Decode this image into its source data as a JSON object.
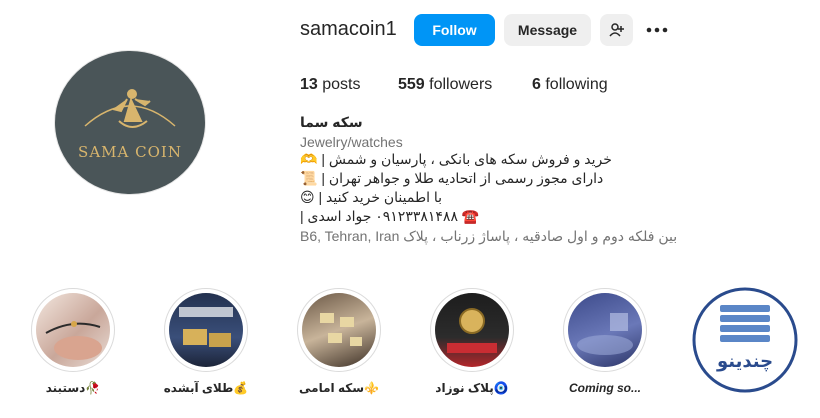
{
  "profile": {
    "username": "samacoin1",
    "avatar_brand": "SAMA COIN",
    "buttons": {
      "follow": "Follow",
      "message": "Message"
    },
    "icons": {
      "add_user": "add-user-icon",
      "more": "more-horizontal-icon"
    }
  },
  "stats": {
    "posts_count": "13",
    "posts_label": " posts",
    "followers_count": "559",
    "followers_label": " followers",
    "following_count": "6",
    "following_label": " following"
  },
  "bio": {
    "name": "سکه سما",
    "category": "Jewelry/watches",
    "lines": [
      "خرید و فروش سکه های بانکی ، پارسیان و شمش | 🫶",
      "دارای مجوز رسمی از اتحادیه طلا و جواهر تهران | 📜",
      "با اطمینان خرید کنید | 😊",
      "☎️ ۰۹۱۲۳۳۸۱۴۸۸ جواد اسدی |"
    ],
    "address": "B6, Tehran, Iran بین فلکه دوم و اول صادقیه ، پاساژ زرناب ، پلاک"
  },
  "highlights": [
    {
      "label": "دستبند🥀"
    },
    {
      "label": "طلای آبشده💰"
    },
    {
      "label": "سکه امامی⚜️"
    },
    {
      "label": "پلاک نوزاد🧿"
    },
    {
      "label": "Coming so..."
    },
    {
      "label": "",
      "logo_text": "چندینو"
    }
  ],
  "colors": {
    "accent": "#0095f6",
    "avatar_bg": "#4a5558",
    "gold": "#d8b56d"
  }
}
